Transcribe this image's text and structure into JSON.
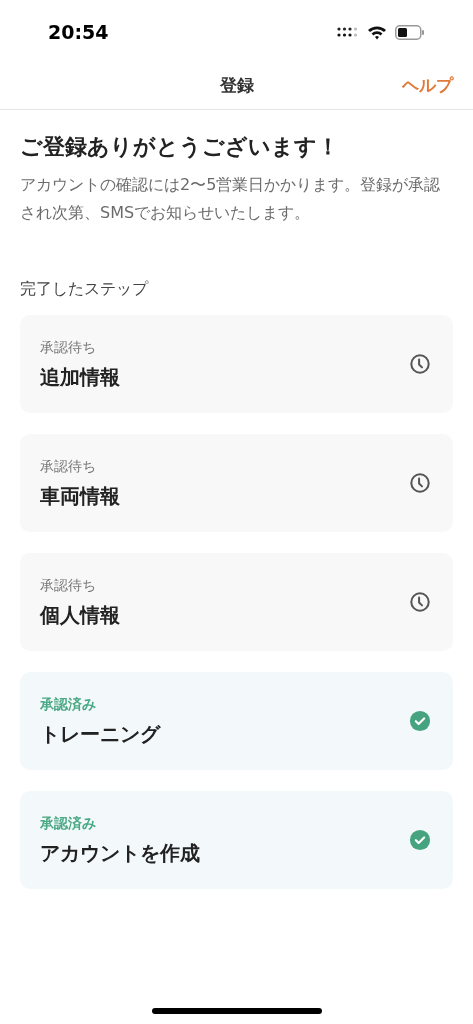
{
  "status_bar": {
    "time": "20:54"
  },
  "nav": {
    "title": "登録",
    "help": "ヘルプ"
  },
  "heading": "ご登録ありがとうございます！",
  "description": "アカウントの確認には2〜5営業日かかります。登録が承認され次第、SMSでお知らせいたします。",
  "section_label": "完了したステップ",
  "steps": [
    {
      "kind": "pending",
      "status": "承認待ち",
      "title": "追加情報"
    },
    {
      "kind": "pending",
      "status": "承認待ち",
      "title": "車両情報"
    },
    {
      "kind": "pending",
      "status": "承認待ち",
      "title": "個人情報"
    },
    {
      "kind": "approved",
      "status": "承認済み",
      "title": "トレーニング"
    },
    {
      "kind": "approved",
      "status": "承認済み",
      "title": "アカウントを作成"
    }
  ]
}
